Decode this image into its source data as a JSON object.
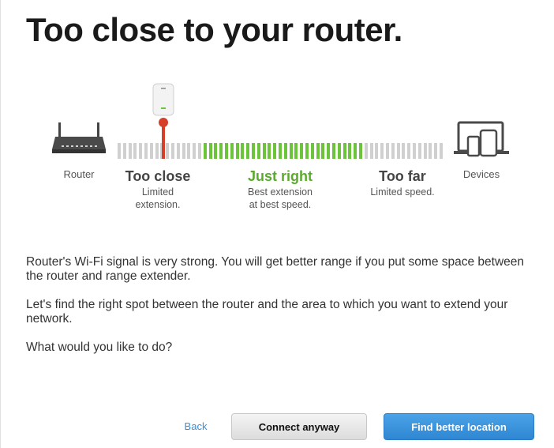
{
  "title": "Too close to your router.",
  "diagram": {
    "router_label": "Router",
    "devices_label": "Devices",
    "zones": [
      {
        "title": "Too close",
        "sub": [
          "Limited",
          "extension."
        ]
      },
      {
        "title": "Just right",
        "sub": [
          "Best extension",
          "at best speed."
        ]
      },
      {
        "title": "Too far",
        "sub": [
          "Limited speed."
        ]
      }
    ],
    "colors": {
      "green": "#6cc43a",
      "gray": "#d0d0d0",
      "marker": "#d6402b"
    }
  },
  "body": {
    "para1": "Router's Wi-Fi signal is very strong. You will get better range if you put some space between the router and range extender.",
    "para2": "Let's find the right spot between the router and the area to which you want to extend your network.",
    "question": "What would you like to do?"
  },
  "actions": {
    "back_label": "Back",
    "connect_label": "Connect anyway",
    "find_label": "Find better location"
  }
}
